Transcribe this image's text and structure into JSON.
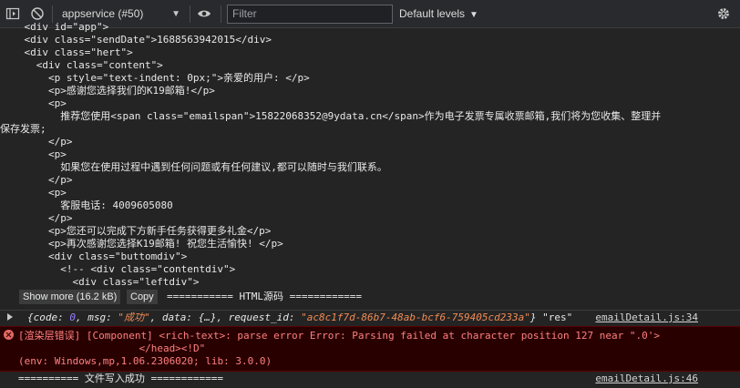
{
  "toolbar": {
    "context": "appservice (#50)",
    "filter_placeholder": "Filter",
    "levels": "Default levels"
  },
  "code_lines": [
    "    <div id=\"app\">",
    "    <div class=\"sendDate\">1688563942015</div>",
    "    <div class=\"hert\">",
    "      <div class=\"content\">",
    "        <p style=\"text-indent: 0px;\">亲爱的用户: </p>",
    "        <p>感谢您选择我们的K19邮箱!</p>",
    "        <p>",
    "          推荐您使用<span class=\"emailspan\">15822068352@9ydata.cn</span>作为电子发票专属收票邮箱,我们将为您收集、整理并",
    "保存发票;",
    "        </p>",
    "        <p>",
    "          如果您在使用过程中遇到任何问题或有任何建议,都可以随时与我们联系。",
    "        </p>",
    "        <p>",
    "          客服电话: 4009605080",
    "        </p>",
    "        <p>您还可以完成下方新手任务获得更多礼金</p>",
    "        <p>再次感谢您选择K19邮箱! 祝您生活愉快! </p>",
    "        <div class=\"buttomdiv\">",
    "          <!-- <div class=\"contentdiv\">",
    "            <div class=\"leftdiv\">"
  ],
  "bottombar": {
    "show_more": "Show more (16.2 kB)",
    "copy": "Copy",
    "label": "=========== HTML源码 ============"
  },
  "log_object": {
    "p1": "{code: ",
    "code": "0",
    "p2": ", msg: ",
    "msg": "\"成功\"",
    "p3": ", data: {…}, request_id: ",
    "request_id": "\"ac8c1f7d-86b7-48ab-bcf6-759405cd233a\"",
    "p4": "} ",
    "res": "\"res\"",
    "source": "emailDetail.js:34"
  },
  "error": {
    "line1": "[渲染层错误] [Component] <rich-text>: parse error Error: Parsing failed at character position 127 near \".0'>",
    "line2": "                    </head><!D\"",
    "line3": "(env: Windows,mp,1.06.2306020; lib: 3.0.0)"
  },
  "success_log": {
    "text": "========== 文件写入成功 ============",
    "source": "emailDetail.js:46"
  }
}
